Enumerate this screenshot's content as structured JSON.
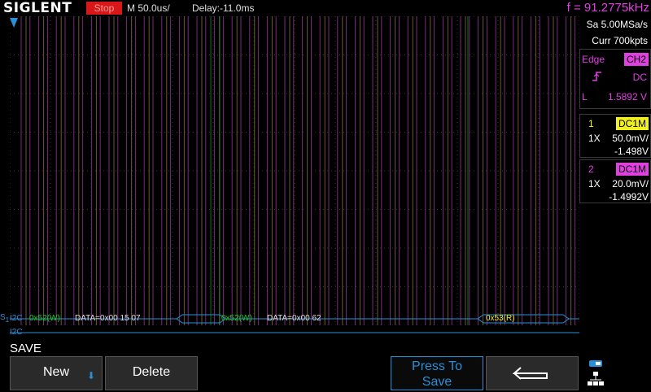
{
  "header": {
    "logo": "SIGLENT",
    "run_state": "Stop",
    "timebase": "M 50.0us/",
    "delay": "Delay:-11.0ms",
    "frequency": "f = 91.2775kHz"
  },
  "acquisition": {
    "sample_rate": "Sa 5.00MSa/s",
    "memory": "Curr 700kpts"
  },
  "trigger": {
    "type": "Edge",
    "source": "CH2",
    "coupling": "DC",
    "level_label": "L",
    "level": "1.5892 V"
  },
  "channels": [
    {
      "num": "1",
      "coupling": "DC1M",
      "probe": "1X",
      "scale": "50.0mV/",
      "offset": "-1.498V",
      "color": "#f0f020"
    },
    {
      "num": "2",
      "coupling": "DC1M",
      "probe": "1X",
      "scale": "20.0mV/",
      "offset": "-1.4992V",
      "color": "#e040e0"
    }
  ],
  "decode": {
    "label_s1": "S",
    "label_s1_sub": "1",
    "bus1": "I2C",
    "bus2": "I2C",
    "frames": [
      {
        "text": "0x52(W)",
        "color": "#20d020"
      },
      {
        "text": "DATA=0x00 15 07",
        "color": "#e0e0e0"
      },
      {
        "text": "0x52(W)",
        "color": "#20d020"
      },
      {
        "text": "DATA=0x00 62",
        "color": "#e0e0e0"
      },
      {
        "text": "0x53(R)",
        "color": "#f0f020"
      }
    ]
  },
  "menu": {
    "title": "SAVE",
    "new_label": "New",
    "delete_label": "Delete",
    "press_to_save_line1": "Press To",
    "press_to_save_line2": "Save"
  },
  "icons": {
    "back": "return-arrow-icon",
    "network": "network-icon",
    "trigger_marker": "trigger-position-icon"
  },
  "colors": {
    "stop": "#d81818",
    "ch1": "#f0f020",
    "ch2": "#e040e0",
    "bus": "#2a8fd8"
  }
}
